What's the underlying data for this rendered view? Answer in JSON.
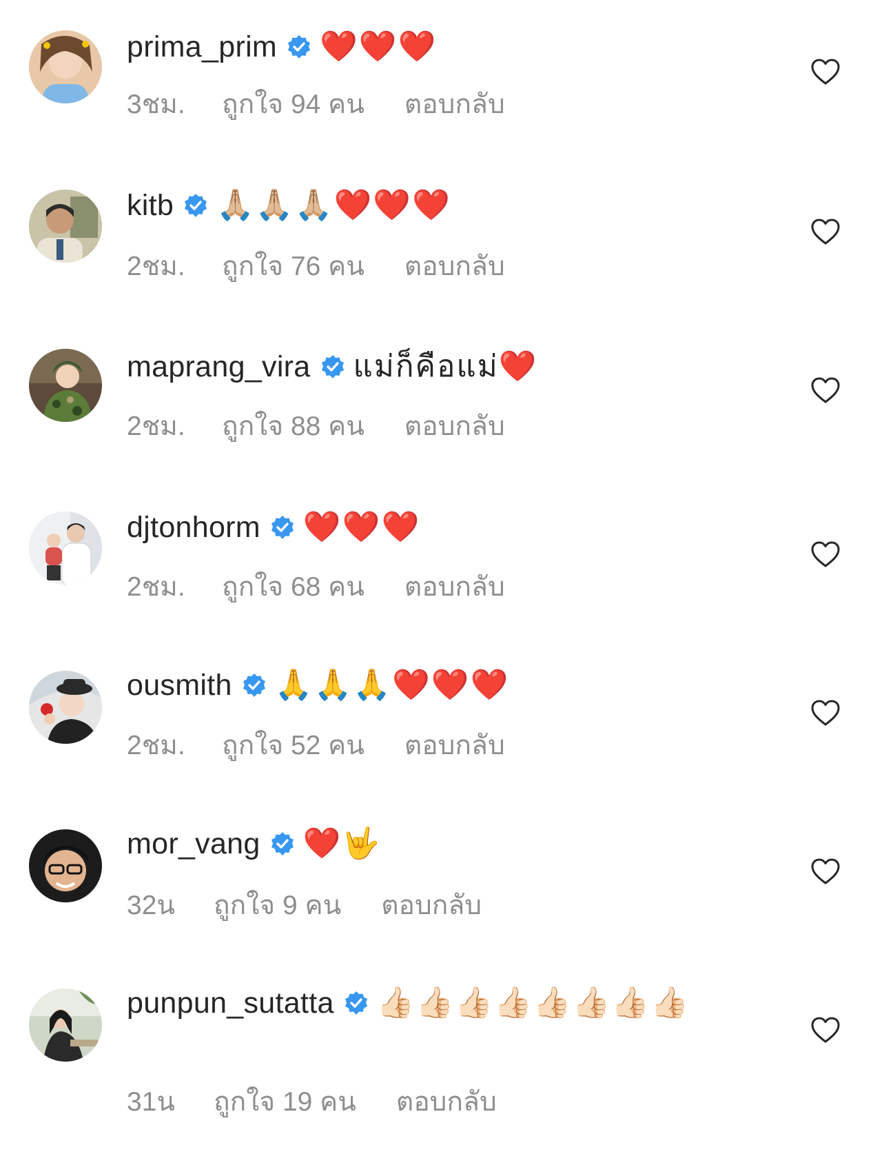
{
  "colors": {
    "text": "#262626",
    "meta": "#8e8e8e",
    "verified": "#3897f0",
    "heart_outline": "#262626"
  },
  "icons": {
    "verified": "verified-badge-icon",
    "like": "heart-outline-icon"
  },
  "reply_label": "ตอบกลับ",
  "comments": [
    {
      "username": "prima_prim",
      "text": "❤️❤️❤️",
      "time": "3ชม.",
      "likes": "ถูกใจ 94 คน",
      "reply": "ตอบกลับ"
    },
    {
      "username": "kitb",
      "text": "🙏🏼🙏🏼🙏🏼❤️❤️❤️",
      "time": "2ชม.",
      "likes": "ถูกใจ 76 คน",
      "reply": "ตอบกลับ"
    },
    {
      "username": "maprang_vira",
      "text": "แม่ก็คือแม่❤️",
      "time": "2ชม.",
      "likes": "ถูกใจ 88 คน",
      "reply": "ตอบกลับ"
    },
    {
      "username": "djtonhorm",
      "text": "❤️❤️❤️",
      "time": "2ชม.",
      "likes": "ถูกใจ 68 คน",
      "reply": "ตอบกลับ"
    },
    {
      "username": "ousmith",
      "text": "🙏🙏🙏❤️❤️❤️",
      "time": "2ชม.",
      "likes": "ถูกใจ 52 คน",
      "reply": "ตอบกลับ"
    },
    {
      "username": "mor_vang",
      "text": "❤️🤟",
      "time": "32น",
      "likes": "ถูกใจ 9 คน",
      "reply": "ตอบกลับ"
    },
    {
      "username": "punpun_sutatta",
      "text": "👍🏻👍🏻👍🏻👍🏻👍🏻👍🏻👍🏻👍🏻",
      "time": "31น",
      "likes": "ถูกใจ 19 คน",
      "reply": "ตอบกลับ"
    }
  ]
}
